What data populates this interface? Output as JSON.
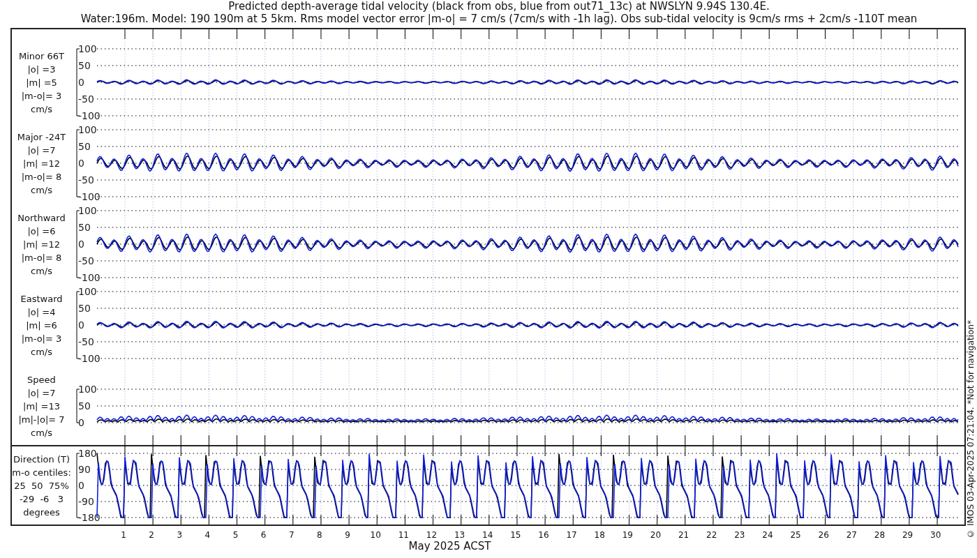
{
  "title": {
    "line_1": "Predicted depth-average tidal velocity (black from obs, blue from out71_13c) at NWSLYN 9.94S 130.4E.",
    "line_2": "Water:196m. Model: 190 190m at 5 5km. Rms model vector error |m-o| = 7 cm/s (7cm/s with -1h lag). Obs sub-tidal velocity is 9cm/s rms + 2cm/s -110T mean"
  },
  "panels": [
    {
      "kind": "velocity",
      "label_lines": [
        "Minor 66T",
        "|o| =3",
        "|m| =5",
        "|m-o|= 3",
        "cm/s"
      ],
      "yticks": [
        "100",
        "50",
        "0",
        "-50",
        "-100"
      ]
    },
    {
      "kind": "velocity",
      "label_lines": [
        "Major -24T",
        "|o| =7",
        "|m| =12",
        "|m-o|= 8",
        "cm/s"
      ],
      "yticks": [
        "100",
        "50",
        "0",
        "-50",
        "-100"
      ]
    },
    {
      "kind": "velocity",
      "label_lines": [
        "Northward",
        "|o| =6",
        "|m| =12",
        "|m-o|= 8",
        "cm/s"
      ],
      "yticks": [
        "100",
        "50",
        "0",
        "-50",
        "-100"
      ]
    },
    {
      "kind": "velocity",
      "label_lines": [
        "Eastward",
        "|o| =4",
        "|m| =6",
        "|m-o|= 3",
        "cm/s"
      ],
      "yticks": [
        "100",
        "50",
        "0",
        "-50",
        "-100"
      ]
    },
    {
      "kind": "speed",
      "label_lines": [
        "Speed",
        "|o| =7",
        "|m| =13",
        "|m|-|o|= 7",
        "cm/s"
      ],
      "yticks": [
        "100",
        "50",
        "0"
      ]
    },
    {
      "kind": "direction",
      "label_lines": [
        "Direction (T)",
        "m-o centiles:",
        "25  50  75%",
        "-29  -6   3",
        "degrees"
      ],
      "yticks": [
        "180",
        "90",
        "0",
        "-90",
        "-180"
      ]
    }
  ],
  "x_axis": {
    "day_labels": [
      "1",
      "2",
      "3",
      "4",
      "5",
      "6",
      "7",
      "8",
      "9",
      "10",
      "11",
      "12",
      "13",
      "14",
      "15",
      "16",
      "17",
      "18",
      "19",
      "20",
      "21",
      "22",
      "23",
      "24",
      "25",
      "26",
      "27",
      "28",
      "29",
      "30"
    ],
    "label": "May 2025 ACST"
  },
  "footer": "© IMOS 03-Apr-2025 07:21:04. *Not for navigation*"
}
